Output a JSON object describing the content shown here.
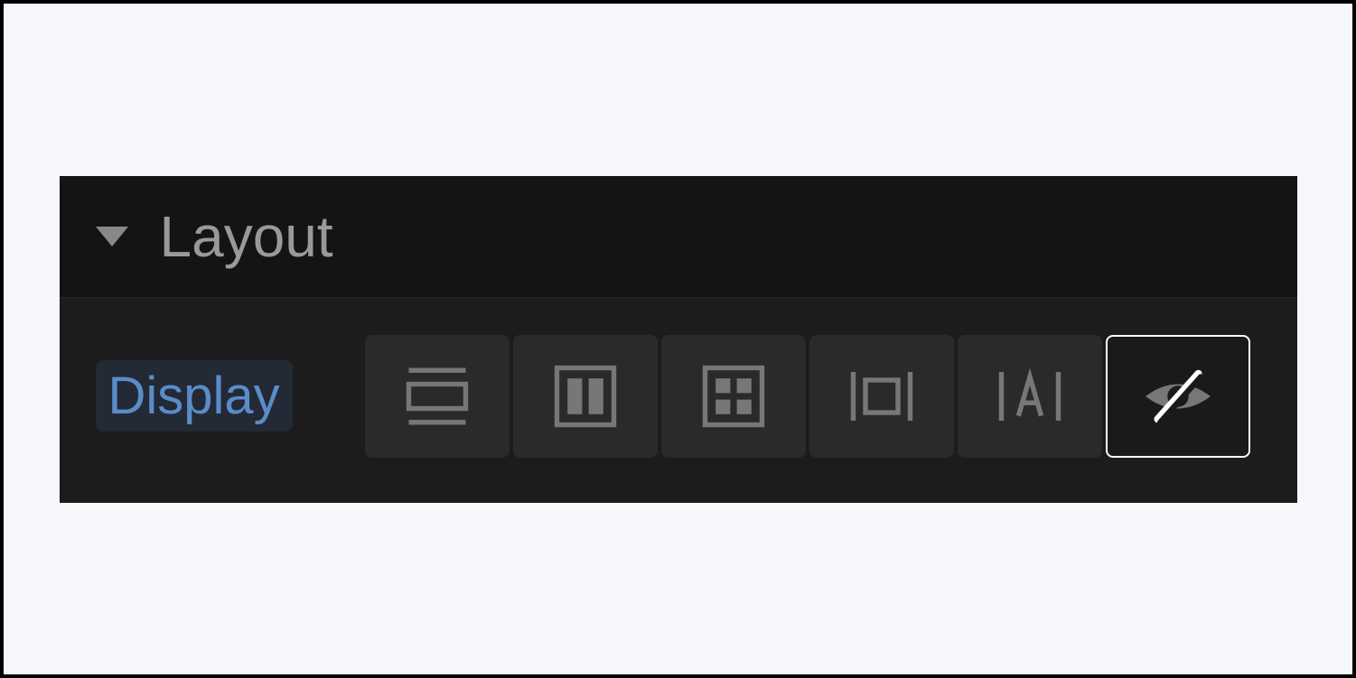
{
  "section": {
    "title": "Layout"
  },
  "property": {
    "label": "Display",
    "options": [
      {
        "name": "block",
        "selected": false
      },
      {
        "name": "flex",
        "selected": false
      },
      {
        "name": "grid",
        "selected": false
      },
      {
        "name": "inline-block",
        "selected": false
      },
      {
        "name": "inline",
        "selected": false
      },
      {
        "name": "none",
        "selected": true
      }
    ]
  }
}
